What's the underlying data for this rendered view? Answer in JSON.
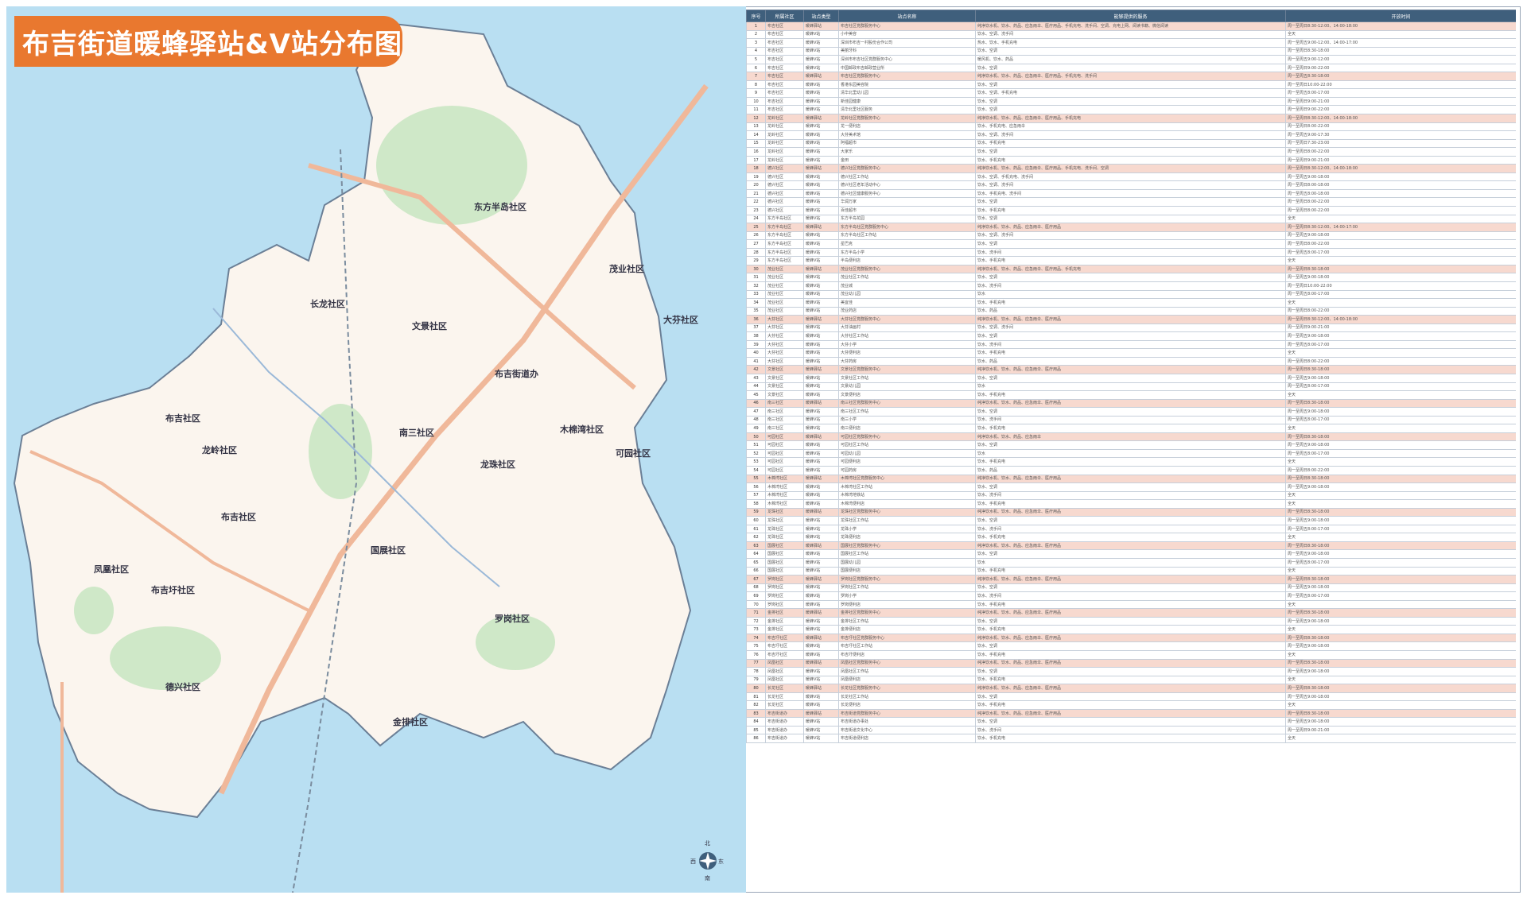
{
  "title": "布吉街道暖蜂驿站&V站分布图",
  "map": {
    "districts": [
      {
        "id": "dongfang",
        "label": "东方半岛社区"
      },
      {
        "id": "maoye",
        "label": "茂业社区"
      },
      {
        "id": "changlong",
        "label": "长龙社区"
      },
      {
        "id": "wenjing",
        "label": "文景社区"
      },
      {
        "id": "dafen",
        "label": "大芬社区"
      },
      {
        "id": "bujijiedaoban",
        "label": "布吉街道办"
      },
      {
        "id": "buji",
        "label": "布吉社区"
      },
      {
        "id": "longling",
        "label": "龙岭社区"
      },
      {
        "id": "nansan",
        "label": "南三社区"
      },
      {
        "id": "mumianwan",
        "label": "木棉湾社区"
      },
      {
        "id": "kejie",
        "label": "可园社区"
      },
      {
        "id": "longzhu",
        "label": "龙珠社区"
      },
      {
        "id": "bujiqu",
        "label": "布吉社区"
      },
      {
        "id": "fengshan",
        "label": "凤凰社区"
      },
      {
        "id": "bujisan",
        "label": "布吉圩社区"
      },
      {
        "id": "guoling",
        "label": "国展社区"
      },
      {
        "id": "luogang",
        "label": "罗岗社区"
      },
      {
        "id": "dexing",
        "label": "德兴社区"
      },
      {
        "id": "jinpai",
        "label": "金排社区"
      }
    ],
    "compass": {
      "north": "北",
      "south": "南",
      "east": "东",
      "west": "西"
    }
  },
  "table": {
    "columns": [
      "序号",
      "所属社区",
      "站点类型",
      "站点名称",
      "能够提供的服务",
      "开放时间"
    ],
    "rows": [
      [
        "1",
        "布吉社区",
        "暖蜂驿站",
        "布吉社区党群服务中心",
        "纯净饮水机、饮水、药品、应急雨伞、医疗用品、手机充电、洗手间、空调、充电上网、阅读书籍、微信阅读",
        "周一至周日8:30-12:00、14:00-18:00"
      ],
      [
        "2",
        "布吉社区",
        "暖蜂V站",
        "小中美容",
        "饮水、空调、洗手间",
        "全天"
      ],
      [
        "3",
        "布吉社区",
        "暖蜂V站",
        "深圳市布吉一村股份合作公司",
        "热水、饮水、手机充电",
        "周一至周五9:00-12:00、14:00-17:00"
      ],
      [
        "4",
        "布吉社区",
        "暖蜂V站",
        "美丽牙科",
        "饮水、空调",
        "周一至周日8:30-18:00"
      ],
      [
        "5",
        "布吉社区",
        "暖蜂V站",
        "深圳市布吉社区党群服务中心",
        "暖风机、饮水、药品",
        "周一至周五9:00-12:00"
      ],
      [
        "6",
        "布吉社区",
        "暖蜂V站",
        "中国邮政布吉邮政营业所",
        "饮水、空调",
        "周一至周日9:00-22:00"
      ],
      [
        "7",
        "布吉社区",
        "暖蜂驿站",
        "布吉社区党群服务中心",
        "纯净饮水机、饮水、药品、应急雨伞、医疗用品、手机充电、洗手间",
        "周一至周五8:30-18:00"
      ],
      [
        "8",
        "布吉社区",
        "暖蜂V站",
        "香港东园美容院",
        "饮水、空调",
        "周一至周日10:00-22:00"
      ],
      [
        "9",
        "布吉社区",
        "暖蜂V站",
        "清华北里幼儿园",
        "饮水、空调、手机充电",
        "周一至周五8:00-17:00"
      ],
      [
        "10",
        "布吉社区",
        "暖蜂V站",
        "新佳园健康",
        "饮水、空调",
        "周一至周日9:00-21:00"
      ],
      [
        "11",
        "布吉社区",
        "暖蜂V站",
        "清华北里社区服务",
        "饮水、空调",
        "周一至周日9:00-22:00"
      ],
      [
        "12",
        "龙岭社区",
        "暖蜂驿站",
        "龙岭社区党群服务中心",
        "纯净饮水机、饮水、药品、应急雨伞、医疗用品、手机充电",
        "周一至周日8:30-12:00、14:00-18:00"
      ],
      [
        "13",
        "龙岭社区",
        "暖蜂V站",
        "龙一便利店",
        "饮水、手机充电、应急雨伞",
        "周一至周日8:00-22:00"
      ],
      [
        "14",
        "龙岭社区",
        "暖蜂V站",
        "大芬美术馆",
        "饮水、空调、洗手间",
        "周一至周五9:00-17:30"
      ],
      [
        "15",
        "龙岭社区",
        "暖蜂V站",
        "阿福超市",
        "饮水、手机充电",
        "周一至周日7:30-23:00"
      ],
      [
        "16",
        "龙岭社区",
        "暖蜂V站",
        "大家乐",
        "饮水、空调",
        "周一至周日8:00-22:00"
      ],
      [
        "17",
        "龙岭社区",
        "暖蜂V站",
        "金田",
        "饮水、手机充电",
        "周一至周日9:00-21:00"
      ],
      [
        "18",
        "德兴社区",
        "暖蜂驿站",
        "德兴社区党群服务中心",
        "纯净饮水机、饮水、药品、应急雨伞、医疗用品、手机充电、洗手间、空调",
        "周一至周日8:30-12:00、14:00-18:00"
      ],
      [
        "19",
        "德兴社区",
        "暖蜂V站",
        "德兴社区工作站",
        "饮水、空调、手机充电、洗手间",
        "周一至周五9:00-18:00"
      ],
      [
        "20",
        "德兴社区",
        "暖蜂V站",
        "德兴社区老年活动中心",
        "饮水、空调、洗手间",
        "周一至周日8:00-18:00"
      ],
      [
        "21",
        "德兴社区",
        "暖蜂V站",
        "德兴社区健康服务中心",
        "饮水、手机充电、洗手间",
        "周一至周五8:00-18:00"
      ],
      [
        "22",
        "德兴社区",
        "暖蜂V站",
        "华润万家",
        "饮水、空调",
        "周一至周日8:00-22:00"
      ],
      [
        "23",
        "德兴社区",
        "暖蜂V站",
        "百佳超市",
        "饮水、手机充电",
        "周一至周日8:00-22:00"
      ],
      [
        "24",
        "东方半岛社区",
        "暖蜂V站",
        "东方半岛花园",
        "饮水、空调",
        "全天"
      ],
      [
        "25",
        "东方半岛社区",
        "暖蜂驿站",
        "东方半岛社区党群服务中心",
        "纯净饮水机、饮水、药品、应急雨伞、医疗用品",
        "周一至周日8:30-12:00、14:00-17:00"
      ],
      [
        "26",
        "东方半岛社区",
        "暖蜂V站",
        "东方半岛社区工作站",
        "饮水、空调、洗手间",
        "周一至周五9:00-18:00"
      ],
      [
        "27",
        "东方半岛社区",
        "暖蜂V站",
        "星巴克",
        "饮水、空调",
        "周一至周日8:00-22:00"
      ],
      [
        "28",
        "东方半岛社区",
        "暖蜂V站",
        "东方半岛小学",
        "饮水、洗手间",
        "周一至周五8:00-17:00"
      ],
      [
        "29",
        "东方半岛社区",
        "暖蜂V站",
        "半岛便利店",
        "饮水、手机充电",
        "全天"
      ],
      [
        "30",
        "茂业社区",
        "暖蜂驿站",
        "茂业社区党群服务中心",
        "纯净饮水机、饮水、药品、应急雨伞、医疗用品、手机充电",
        "周一至周日8:30-18:00"
      ],
      [
        "31",
        "茂业社区",
        "暖蜂V站",
        "茂业社区工作站",
        "饮水、空调",
        "周一至周五9:00-18:00"
      ],
      [
        "32",
        "茂业社区",
        "暖蜂V站",
        "茂业城",
        "饮水、洗手间",
        "周一至周日10:00-22:00"
      ],
      [
        "33",
        "茂业社区",
        "暖蜂V站",
        "茂业幼儿园",
        "饮水",
        "周一至周五8:00-17:00"
      ],
      [
        "34",
        "茂业社区",
        "暖蜂V站",
        "美宜佳",
        "饮水、手机充电",
        "全天"
      ],
      [
        "35",
        "茂业社区",
        "暖蜂V站",
        "茂业药店",
        "饮水、药品",
        "周一至周日8:00-22:00"
      ],
      [
        "36",
        "大芬社区",
        "暖蜂驿站",
        "大芬社区党群服务中心",
        "纯净饮水机、饮水、药品、应急雨伞、医疗用品",
        "周一至周日8:30-12:00、14:00-18:00"
      ],
      [
        "37",
        "大芬社区",
        "暖蜂V站",
        "大芬油画村",
        "饮水、空调、洗手间",
        "周一至周日9:00-21:00"
      ],
      [
        "38",
        "大芬社区",
        "暖蜂V站",
        "大芬社区工作站",
        "饮水、空调",
        "周一至周五9:00-18:00"
      ],
      [
        "39",
        "大芬社区",
        "暖蜂V站",
        "大芬小学",
        "饮水、洗手间",
        "周一至周五8:00-17:00"
      ],
      [
        "40",
        "大芬社区",
        "暖蜂V站",
        "大芬便利店",
        "饮水、手机充电",
        "全天"
      ],
      [
        "41",
        "大芬社区",
        "暖蜂V站",
        "大芬药房",
        "饮水、药品",
        "周一至周日8:00-22:00"
      ],
      [
        "42",
        "文景社区",
        "暖蜂驿站",
        "文景社区党群服务中心",
        "纯净饮水机、饮水、药品、应急雨伞、医疗用品",
        "周一至周日8:30-18:00"
      ],
      [
        "43",
        "文景社区",
        "暖蜂V站",
        "文景社区工作站",
        "饮水、空调",
        "周一至周五9:00-18:00"
      ],
      [
        "44",
        "文景社区",
        "暖蜂V站",
        "文景幼儿园",
        "饮水",
        "周一至周五8:00-17:00"
      ],
      [
        "45",
        "文景社区",
        "暖蜂V站",
        "文景便利店",
        "饮水、手机充电",
        "全天"
      ],
      [
        "46",
        "南三社区",
        "暖蜂驿站",
        "南三社区党群服务中心",
        "纯净饮水机、饮水、药品、应急雨伞、医疗用品",
        "周一至周日8:30-18:00"
      ],
      [
        "47",
        "南三社区",
        "暖蜂V站",
        "南三社区工作站",
        "饮水、空调",
        "周一至周五9:00-18:00"
      ],
      [
        "48",
        "南三社区",
        "暖蜂V站",
        "南三小学",
        "饮水、洗手间",
        "周一至周五8:00-17:00"
      ],
      [
        "49",
        "南三社区",
        "暖蜂V站",
        "南三便利店",
        "饮水、手机充电",
        "全天"
      ],
      [
        "50",
        "可园社区",
        "暖蜂驿站",
        "可园社区党群服务中心",
        "纯净饮水机、饮水、药品、应急雨伞",
        "周一至周日8:30-18:00"
      ],
      [
        "51",
        "可园社区",
        "暖蜂V站",
        "可园社区工作站",
        "饮水、空调",
        "周一至周五9:00-18:00"
      ],
      [
        "52",
        "可园社区",
        "暖蜂V站",
        "可园幼儿园",
        "饮水",
        "周一至周五8:00-17:00"
      ],
      [
        "53",
        "可园社区",
        "暖蜂V站",
        "可园便利店",
        "饮水、手机充电",
        "全天"
      ],
      [
        "54",
        "可园社区",
        "暖蜂V站",
        "可园药房",
        "饮水、药品",
        "周一至周日8:00-22:00"
      ],
      [
        "55",
        "木棉湾社区",
        "暖蜂驿站",
        "木棉湾社区党群服务中心",
        "纯净饮水机、饮水、药品、应急雨伞、医疗用品",
        "周一至周日8:30-18:00"
      ],
      [
        "56",
        "木棉湾社区",
        "暖蜂V站",
        "木棉湾社区工作站",
        "饮水、空调",
        "周一至周五9:00-18:00"
      ],
      [
        "57",
        "木棉湾社区",
        "暖蜂V站",
        "木棉湾地铁站",
        "饮水、洗手间",
        "全天"
      ],
      [
        "58",
        "木棉湾社区",
        "暖蜂V站",
        "木棉湾便利店",
        "饮水、手机充电",
        "全天"
      ],
      [
        "59",
        "龙珠社区",
        "暖蜂驿站",
        "龙珠社区党群服务中心",
        "纯净饮水机、饮水、药品、应急雨伞、医疗用品",
        "周一至周日8:30-18:00"
      ],
      [
        "60",
        "龙珠社区",
        "暖蜂V站",
        "龙珠社区工作站",
        "饮水、空调",
        "周一至周五9:00-18:00"
      ],
      [
        "61",
        "龙珠社区",
        "暖蜂V站",
        "龙珠小学",
        "饮水、洗手间",
        "周一至周五8:00-17:00"
      ],
      [
        "62",
        "龙珠社区",
        "暖蜂V站",
        "龙珠便利店",
        "饮水、手机充电",
        "全天"
      ],
      [
        "63",
        "国展社区",
        "暖蜂驿站",
        "国展社区党群服务中心",
        "纯净饮水机、饮水、药品、应急雨伞、医疗用品",
        "周一至周日8:30-18:00"
      ],
      [
        "64",
        "国展社区",
        "暖蜂V站",
        "国展社区工作站",
        "饮水、空调",
        "周一至周五9:00-18:00"
      ],
      [
        "65",
        "国展社区",
        "暖蜂V站",
        "国展幼儿园",
        "饮水",
        "周一至周五8:00-17:00"
      ],
      [
        "66",
        "国展社区",
        "暖蜂V站",
        "国展便利店",
        "饮水、手机充电",
        "全天"
      ],
      [
        "67",
        "罗岗社区",
        "暖蜂驿站",
        "罗岗社区党群服务中心",
        "纯净饮水机、饮水、药品、应急雨伞、医疗用品",
        "周一至周日8:30-18:00"
      ],
      [
        "68",
        "罗岗社区",
        "暖蜂V站",
        "罗岗社区工作站",
        "饮水、空调",
        "周一至周五9:00-18:00"
      ],
      [
        "69",
        "罗岗社区",
        "暖蜂V站",
        "罗岗小学",
        "饮水、洗手间",
        "周一至周五8:00-17:00"
      ],
      [
        "70",
        "罗岗社区",
        "暖蜂V站",
        "罗岗便利店",
        "饮水、手机充电",
        "全天"
      ],
      [
        "71",
        "金排社区",
        "暖蜂驿站",
        "金排社区党群服务中心",
        "纯净饮水机、饮水、药品、应急雨伞、医疗用品",
        "周一至周日8:30-18:00"
      ],
      [
        "72",
        "金排社区",
        "暖蜂V站",
        "金排社区工作站",
        "饮水、空调",
        "周一至周五9:00-18:00"
      ],
      [
        "73",
        "金排社区",
        "暖蜂V站",
        "金排便利店",
        "饮水、手机充电",
        "全天"
      ],
      [
        "74",
        "布吉圩社区",
        "暖蜂驿站",
        "布吉圩社区党群服务中心",
        "纯净饮水机、饮水、药品、应急雨伞、医疗用品",
        "周一至周日8:30-18:00"
      ],
      [
        "75",
        "布吉圩社区",
        "暖蜂V站",
        "布吉圩社区工作站",
        "饮水、空调",
        "周一至周五9:00-18:00"
      ],
      [
        "76",
        "布吉圩社区",
        "暖蜂V站",
        "布吉圩便利店",
        "饮水、手机充电",
        "全天"
      ],
      [
        "77",
        "凤凰社区",
        "暖蜂驿站",
        "凤凰社区党群服务中心",
        "纯净饮水机、饮水、药品、应急雨伞、医疗用品",
        "周一至周日8:30-18:00"
      ],
      [
        "78",
        "凤凰社区",
        "暖蜂V站",
        "凤凰社区工作站",
        "饮水、空调",
        "周一至周五9:00-18:00"
      ],
      [
        "79",
        "凤凰社区",
        "暖蜂V站",
        "凤凰便利店",
        "饮水、手机充电",
        "全天"
      ],
      [
        "80",
        "长龙社区",
        "暖蜂驿站",
        "长龙社区党群服务中心",
        "纯净饮水机、饮水、药品、应急雨伞、医疗用品",
        "周一至周日8:30-18:00"
      ],
      [
        "81",
        "长龙社区",
        "暖蜂V站",
        "长龙社区工作站",
        "饮水、空调",
        "周一至周五9:00-18:00"
      ],
      [
        "82",
        "长龙社区",
        "暖蜂V站",
        "长龙便利店",
        "饮水、手机充电",
        "全天"
      ],
      [
        "83",
        "布吉街道办",
        "暖蜂驿站",
        "布吉街道党群服务中心",
        "纯净饮水机、饮水、药品、应急雨伞、医疗用品",
        "周一至周日8:30-18:00"
      ],
      [
        "84",
        "布吉街道办",
        "暖蜂V站",
        "布吉街道办事处",
        "饮水、空调",
        "周一至周五9:00-18:00"
      ],
      [
        "85",
        "布吉街道办",
        "暖蜂V站",
        "布吉街道文化中心",
        "饮水、洗手间",
        "周一至周日9:00-21:00"
      ],
      [
        "86",
        "布吉街道办",
        "暖蜂V站",
        "布吉街道便利店",
        "饮水、手机充电",
        "全天"
      ]
    ]
  },
  "colors": {
    "accent": "#e9782f",
    "header": "#3f5f7c",
    "water": "#b9dff2",
    "land": "#fbf5ee",
    "park": "#cfe8c8",
    "road": "#f0b89a",
    "highlight": "#f7d9cf"
  }
}
